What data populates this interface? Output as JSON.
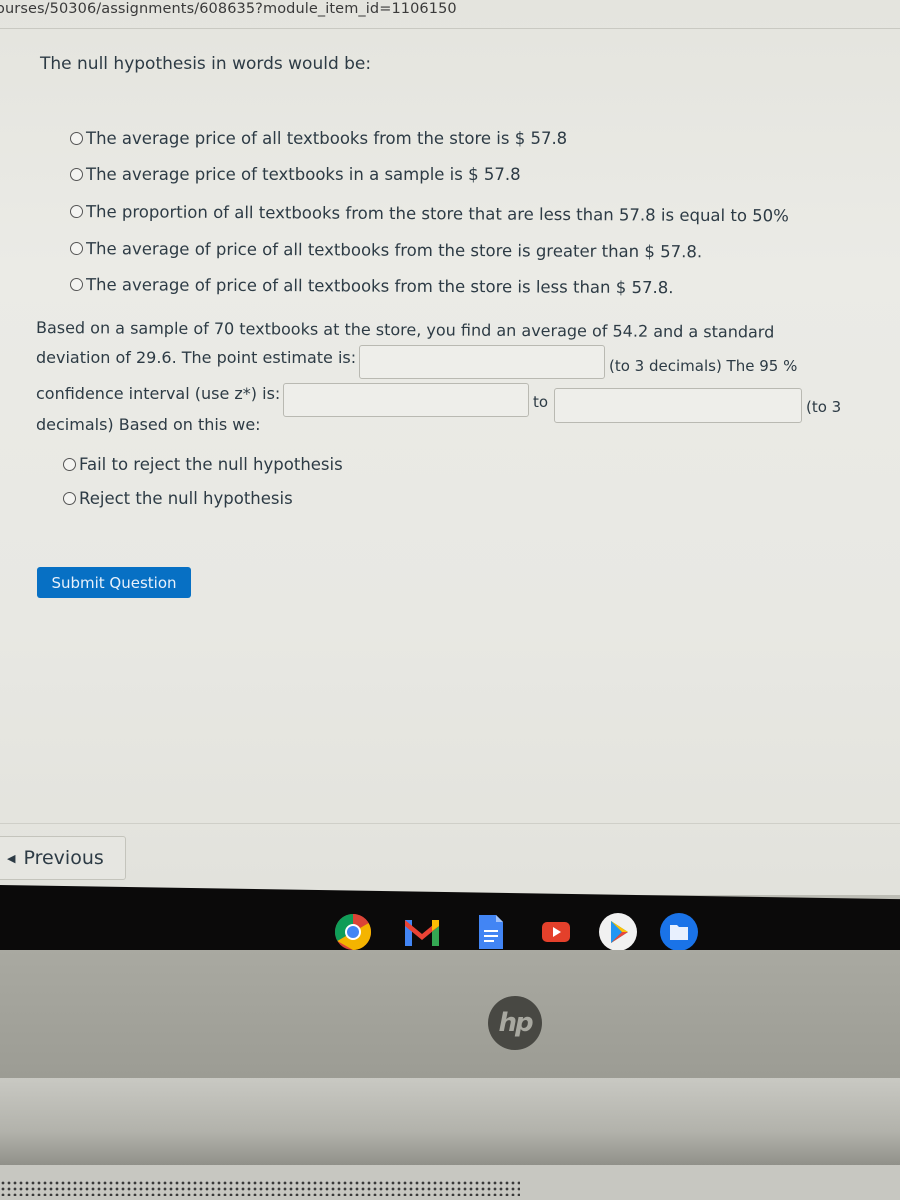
{
  "browser": {
    "url": "ourses/50306/assignments/608635?module_item_id=1106150"
  },
  "question": {
    "prompt": "The null hypothesis in words would be:",
    "null_options": [
      "The average price of all textbooks from the store is $ 57.8",
      "The average price of textbooks in a sample is $ 57.8",
      "The proportion of all textbooks from the store that are less than 57.8 is equal to 50%",
      "The average of price of all textbooks from the store is greater than $ 57.8.",
      "The average of price of all textbooks from the store is less than $ 57.8."
    ],
    "sample_text_line1": "Based on a sample of 70 textbooks at the store, you find an average of 54.2 and a standard",
    "sample_text_line2": "deviation of 29.6. The point estimate is:",
    "point_estimate_value": "",
    "after_point_estimate": "(to 3 decimals) The 95 %",
    "ci_label": "confidence interval (use z*) is:",
    "ci_lower_value": "",
    "ci_to": "to",
    "ci_upper_value": "",
    "after_ci": "(to 3",
    "decimals_line": "decimals) Based on this we:",
    "decision_options": [
      "Fail to reject the null hypothesis",
      "Reject the null hypothesis"
    ],
    "submit_label": "Submit Question"
  },
  "navigation": {
    "previous_label": "Previous"
  },
  "shelf": {
    "apps": [
      "chrome-icon",
      "gmail-icon",
      "google-docs-icon",
      "youtube-icon",
      "play-store-icon",
      "files-icon"
    ]
  },
  "device": {
    "brand": "hp"
  },
  "colors": {
    "submit_button": "#0770c4",
    "text": "#2d3b45"
  }
}
